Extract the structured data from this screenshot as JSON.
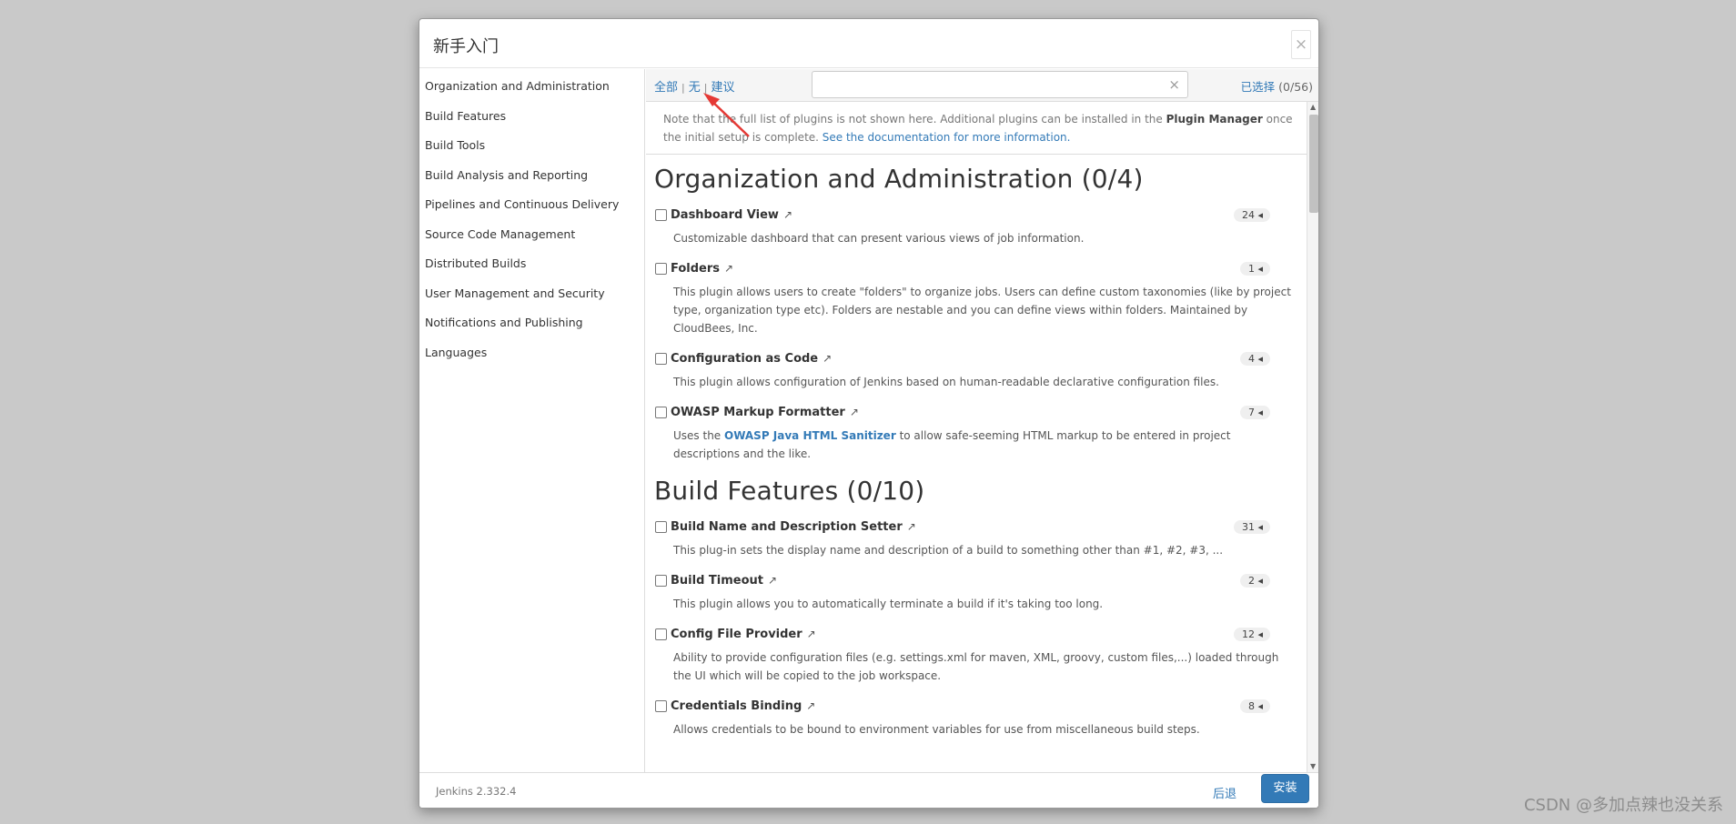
{
  "dialog": {
    "title": "新手入门",
    "close_label": "×"
  },
  "sidebar": {
    "items": [
      {
        "label": "Organization and Administration"
      },
      {
        "label": "Build Features"
      },
      {
        "label": "Build Tools"
      },
      {
        "label": "Build Analysis and Reporting"
      },
      {
        "label": "Pipelines and Continuous Delivery"
      },
      {
        "label": "Source Code Management"
      },
      {
        "label": "Distributed Builds"
      },
      {
        "label": "User Management and Security"
      },
      {
        "label": "Notifications and Publishing"
      },
      {
        "label": "Languages"
      }
    ]
  },
  "toolbar": {
    "filter_all": "全部",
    "filter_none": "无",
    "filter_suggested": "建议",
    "separator": "|",
    "search_value": "",
    "search_placeholder": "",
    "clear_icon": "×",
    "selected_label": "已选择",
    "selected_count": "(0/56)"
  },
  "note": {
    "text_before": "Note that the full list of plugins is not shown here. Additional plugins can be installed in the ",
    "plugin_manager": "Plugin Manager",
    "text_middle": " once the initial setup is complete. ",
    "doc_link": "See the documentation for more information."
  },
  "sections": [
    {
      "title": "Organization and Administration (0/4)",
      "plugins": [
        {
          "name": "Dashboard View",
          "count": "24",
          "desc": "Customizable dashboard that can present various views of job information."
        },
        {
          "name": "Folders",
          "count": "1",
          "desc": "This plugin allows users to create \"folders\" to organize jobs. Users can define custom taxonomies (like by project type, organization type etc). Folders are nestable and you can define views within folders. Maintained by CloudBees, Inc."
        },
        {
          "name": "Configuration as Code",
          "count": "4",
          "desc": "This plugin allows configuration of Jenkins based on human-readable declarative configuration files."
        },
        {
          "name": "OWASP Markup Formatter",
          "count": "7",
          "desc_before": "Uses the ",
          "desc_link": "OWASP Java HTML Sanitizer",
          "desc_after": " to allow safe-seeming HTML markup to be entered in project descriptions and the like."
        }
      ]
    },
    {
      "title": "Build Features (0/10)",
      "plugins": [
        {
          "name": "Build Name and Description Setter",
          "count": "31",
          "desc": "This plug-in sets the display name and description of a build to something other than #1, #2, #3, ..."
        },
        {
          "name": "Build Timeout",
          "count": "2",
          "desc": "This plugin allows you to automatically terminate a build if it's taking too long."
        },
        {
          "name": "Config File Provider",
          "count": "12",
          "desc": "Ability to provide configuration files (e.g. settings.xml for maven, XML, groovy, custom files,...) loaded through the UI which will be copied to the job workspace."
        },
        {
          "name": "Credentials Binding",
          "count": "8",
          "desc": "Allows credentials to be bound to environment variables for use from miscellaneous build steps."
        }
      ]
    }
  ],
  "icons": {
    "external_link": "↗",
    "badge_caret": "◂",
    "scroll_up": "▲",
    "scroll_down": "▼"
  },
  "footer": {
    "version": "Jenkins 2.332.4",
    "back_label": "后退",
    "install_label": "安装"
  },
  "annotation_color": "#e53935",
  "watermark": "CSDN @多加点辣也没关系"
}
